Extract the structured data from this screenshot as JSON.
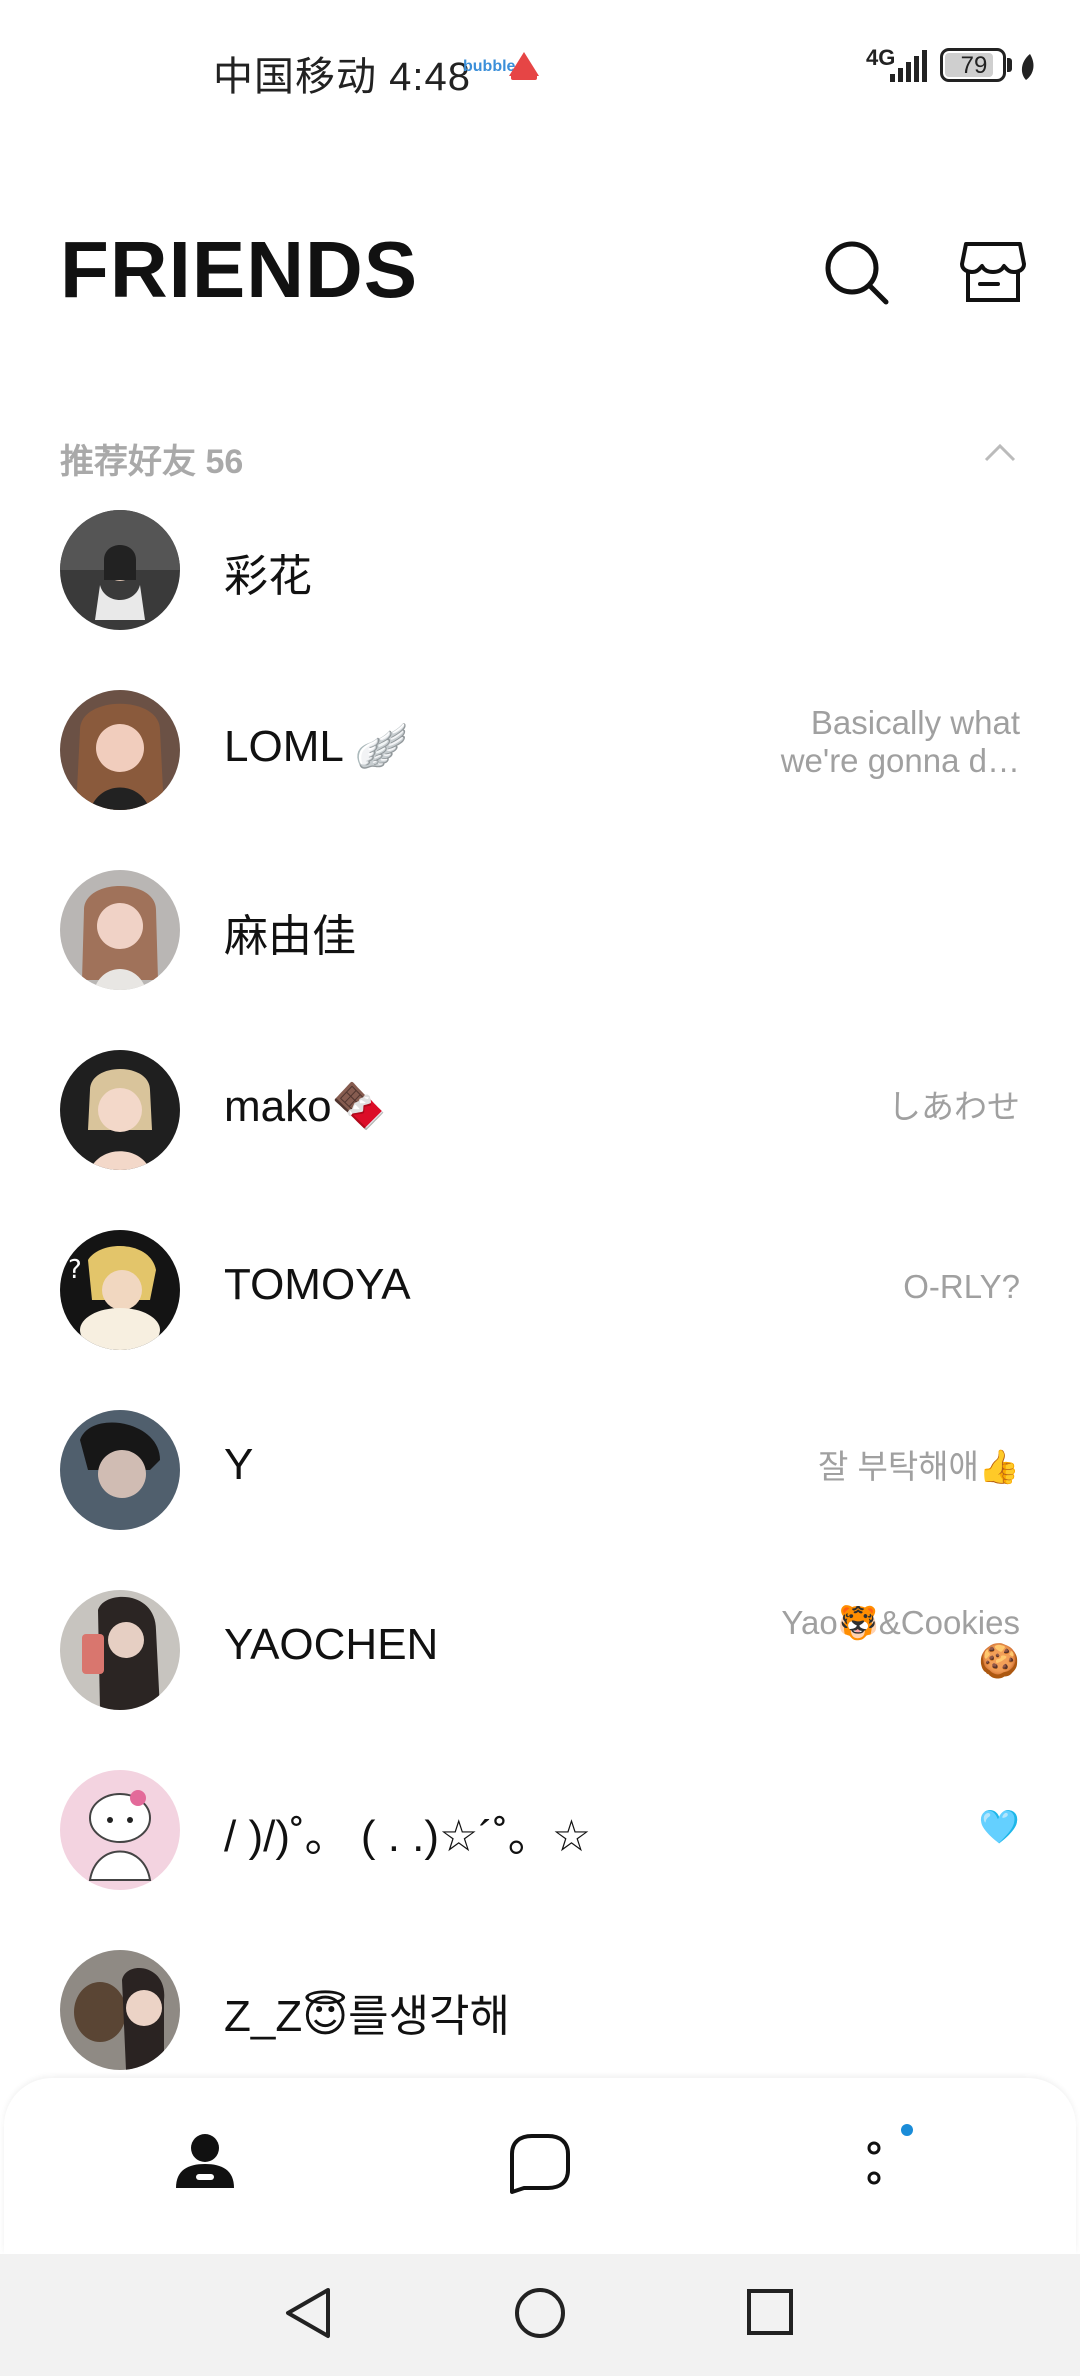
{
  "status_bar": {
    "carrier_time": "中国移动 4:48",
    "network": "4G",
    "battery": "79",
    "app_badge": "bubble"
  },
  "header": {
    "title": "FRIENDS"
  },
  "section": {
    "title": "推荐好友 56"
  },
  "friends": [
    {
      "name": "彩花",
      "status": ""
    },
    {
      "name": "LOML 🪽",
      "status_line1": "Basically what",
      "status_line2": "we're gonna d…"
    },
    {
      "name": "麻由佳",
      "status": ""
    },
    {
      "name": "mako🍫",
      "status": "しあわせ"
    },
    {
      "name": "TOMOYA",
      "status": "O-RLY?"
    },
    {
      "name": "Y",
      "status": "잘 부탁해애👍"
    },
    {
      "name": "YAOCHEN",
      "status_line1": "Yao🐯&Cookies",
      "status_line2": "🍪"
    },
    {
      "name": "/ )/)˚。 ( . .)☆´˚。☆",
      "status": "🩵"
    },
    {
      "name": "Z_Z😇를생각해",
      "status": ""
    }
  ],
  "colors": {
    "accent_dot": "#1a8cd8",
    "secondary_text": "#a0a0a0"
  }
}
